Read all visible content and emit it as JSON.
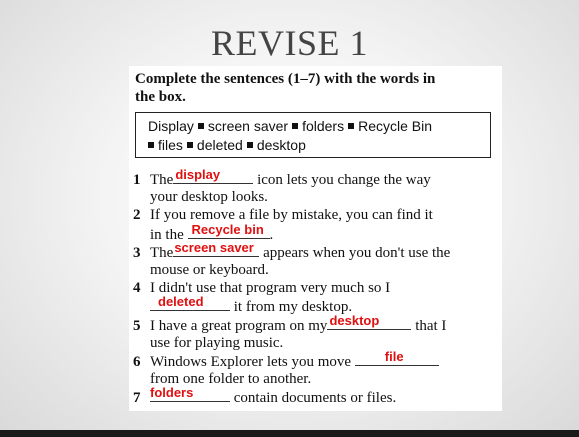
{
  "slide": {
    "title": "REVISE 1"
  },
  "exercise": {
    "instruction_line1": "Complete the sentences (1–7) with the words in",
    "instruction_line2": "the box.",
    "wordbox": [
      "Display",
      "screen saver",
      "folders",
      "Recycle Bin",
      "files",
      "deleted",
      "desktop"
    ]
  },
  "sentences": [
    {
      "num": "1",
      "pre": "The",
      "answer": "display",
      "post": "icon lets you change the way",
      "line2": "your desktop looks."
    },
    {
      "num": "2",
      "line1": "If you remove a file by mistake, you can find it",
      "pre": "in the",
      "answer": "Recycle bin",
      "post": "."
    },
    {
      "num": "3",
      "pre": "The",
      "answer": "screen saver",
      "post": "appears when you don't use the",
      "line2": "mouse or keyboard."
    },
    {
      "num": "4",
      "line1": "I didn't use that program very much so I",
      "answer": "deleted",
      "post": "it from my desktop."
    },
    {
      "num": "5",
      "pre": "I have a great program on my",
      "answer": "desktop",
      "post": "that I",
      "line2": "use for playing music."
    },
    {
      "num": "6",
      "pre": "Windows Explorer lets you move",
      "answer": "file",
      "line2": "from one folder to another."
    },
    {
      "num": "7",
      "answer": "folders",
      "post": "contain documents or files."
    }
  ]
}
